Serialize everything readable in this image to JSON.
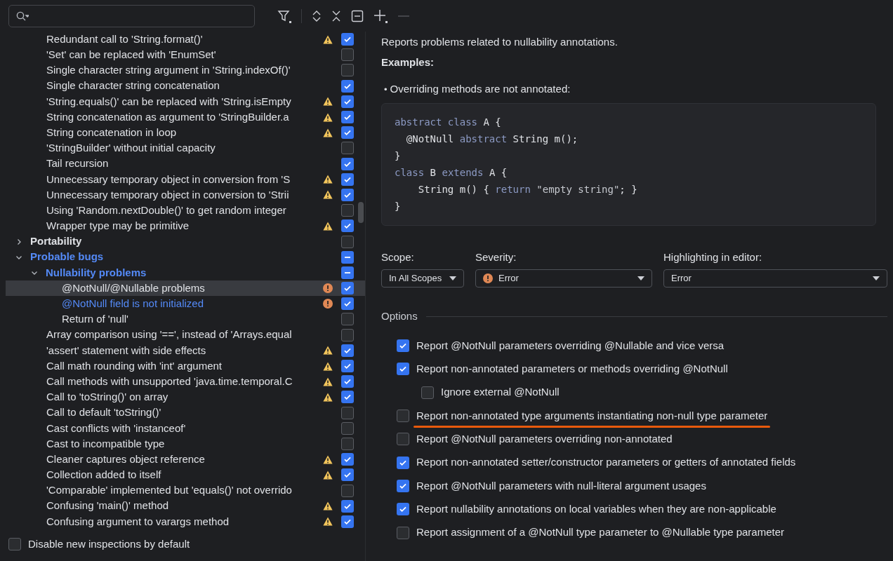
{
  "tree": [
    {
      "kind": "category",
      "children": [
        {
          "kind": "leaf",
          "label": "Redundant call to 'String.format()'",
          "warning": true,
          "error": false,
          "checked": true,
          "modified": false,
          "selected": false
        },
        {
          "kind": "leaf",
          "label": "'Set' can be replaced with 'EnumSet'",
          "warning": false,
          "error": false,
          "checked": false,
          "modified": false,
          "selected": false
        },
        {
          "kind": "leaf",
          "label": "Single character string argument in 'String.indexOf()'",
          "warning": false,
          "error": false,
          "checked": false,
          "modified": false,
          "selected": false
        },
        {
          "kind": "leaf",
          "label": "Single character string concatenation",
          "warning": false,
          "error": false,
          "checked": true,
          "modified": false,
          "selected": false
        },
        {
          "kind": "leaf",
          "label": "'String.equals()' can be replaced with 'String.isEmpty",
          "warning": true,
          "error": false,
          "checked": true,
          "modified": false,
          "selected": false
        },
        {
          "kind": "leaf",
          "label": "String concatenation as argument to 'StringBuilder.a",
          "warning": true,
          "error": false,
          "checked": true,
          "modified": false,
          "selected": false
        },
        {
          "kind": "leaf",
          "label": "String concatenation in loop",
          "warning": true,
          "error": false,
          "checked": true,
          "modified": false,
          "selected": false
        },
        {
          "kind": "leaf",
          "label": "'StringBuilder' without initial capacity",
          "warning": false,
          "error": false,
          "checked": false,
          "modified": false,
          "selected": false
        },
        {
          "kind": "leaf",
          "label": "Tail recursion",
          "warning": false,
          "error": false,
          "checked": true,
          "modified": false,
          "selected": false
        },
        {
          "kind": "leaf",
          "label": "Unnecessary temporary object in conversion from 'S",
          "warning": true,
          "error": false,
          "checked": true,
          "modified": false,
          "selected": false
        },
        {
          "kind": "leaf",
          "label": "Unnecessary temporary object in conversion to 'Strii",
          "warning": true,
          "error": false,
          "checked": true,
          "modified": false,
          "selected": false
        },
        {
          "kind": "leaf",
          "label": "Using 'Random.nextDouble()' to get random integer",
          "warning": false,
          "error": false,
          "checked": false,
          "modified": false,
          "selected": false
        },
        {
          "kind": "leaf",
          "label": "Wrapper type may be primitive",
          "warning": true,
          "error": false,
          "checked": true,
          "modified": false,
          "selected": false
        }
      ]
    },
    {
      "kind": "category",
      "label": "Portability",
      "expanded": false,
      "checked": false,
      "partial": false,
      "modified": false,
      "selected": false
    },
    {
      "kind": "category",
      "label": "Probable bugs",
      "expanded": true,
      "checked": false,
      "partial": true,
      "modified": true,
      "selected": false,
      "children": [
        {
          "kind": "category",
          "label": "Nullability problems",
          "expanded": true,
          "checked": false,
          "partial": true,
          "modified": true,
          "selected": false,
          "children": [
            {
              "kind": "leaf",
              "label": "@NotNull/@Nullable problems",
              "warning": false,
              "error": true,
              "checked": true,
              "modified": false,
              "selected": true
            },
            {
              "kind": "leaf",
              "label": "@NotNull field is not initialized",
              "warning": false,
              "error": true,
              "checked": true,
              "modified": true,
              "selected": false
            },
            {
              "kind": "leaf",
              "label": "Return of 'null'",
              "warning": false,
              "error": false,
              "checked": false,
              "modified": false,
              "selected": false
            }
          ]
        },
        {
          "kind": "leaf",
          "label": "Array comparison using '==', instead of 'Arrays.equal",
          "warning": false,
          "error": false,
          "checked": false,
          "modified": false,
          "selected": false
        },
        {
          "kind": "leaf",
          "label": "'assert' statement with side effects",
          "warning": true,
          "error": false,
          "checked": true,
          "modified": false,
          "selected": false
        },
        {
          "kind": "leaf",
          "label": "Call math rounding with 'int' argument",
          "warning": true,
          "error": false,
          "checked": true,
          "modified": false,
          "selected": false
        },
        {
          "kind": "leaf",
          "label": "Call methods with unsupported 'java.time.temporal.C",
          "warning": true,
          "error": false,
          "checked": true,
          "modified": false,
          "selected": false
        },
        {
          "kind": "leaf",
          "label": "Call to 'toString()' on array",
          "warning": true,
          "error": false,
          "checked": true,
          "modified": false,
          "selected": false
        },
        {
          "kind": "leaf",
          "label": "Call to default 'toString()'",
          "warning": false,
          "error": false,
          "checked": false,
          "modified": false,
          "selected": false
        },
        {
          "kind": "leaf",
          "label": "Cast conflicts with 'instanceof'",
          "warning": false,
          "error": false,
          "checked": false,
          "modified": false,
          "selected": false
        },
        {
          "kind": "leaf",
          "label": "Cast to incompatible type",
          "warning": false,
          "error": false,
          "checked": false,
          "modified": false,
          "selected": false
        },
        {
          "kind": "leaf",
          "label": "Cleaner captures object reference",
          "warning": true,
          "error": false,
          "checked": true,
          "modified": false,
          "selected": false
        },
        {
          "kind": "leaf",
          "label": "Collection added to itself",
          "warning": true,
          "error": false,
          "checked": true,
          "modified": false,
          "selected": false
        },
        {
          "kind": "leaf",
          "label": "'Comparable' implemented but 'equals()' not overrido",
          "warning": false,
          "error": false,
          "checked": false,
          "modified": false,
          "selected": false
        },
        {
          "kind": "leaf",
          "label": "Confusing 'main()' method",
          "warning": true,
          "error": false,
          "checked": true,
          "modified": false,
          "selected": false
        },
        {
          "kind": "leaf",
          "label": "Confusing argument to varargs method",
          "warning": true,
          "error": false,
          "checked": true,
          "modified": false,
          "selected": false
        }
      ]
    }
  ],
  "bottom_option": {
    "label": "Disable new inspections by default",
    "checked": false
  },
  "description": {
    "text": "Reports problems related to nullability annotations.",
    "examples_heading": "Examples:",
    "bullet": "•",
    "bullet_text": "Overriding methods are not annotated:",
    "code": [
      [
        {
          "kind": "keyword",
          "text": "abstract class"
        },
        {
          "kind": "plain",
          "text": " A {"
        }
      ],
      [
        {
          "kind": "plain",
          "text": "  @NotNull "
        },
        {
          "kind": "keyword",
          "text": "abstract"
        },
        {
          "kind": "plain",
          "text": " String m();"
        }
      ],
      [
        {
          "kind": "plain",
          "text": "}"
        }
      ],
      [
        {
          "kind": "keyword",
          "text": "class"
        },
        {
          "kind": "plain",
          "text": " B "
        },
        {
          "kind": "keyword",
          "text": "extends"
        },
        {
          "kind": "plain",
          "text": " A {"
        }
      ],
      [
        {
          "kind": "plain",
          "text": "    String m() { "
        },
        {
          "kind": "keyword",
          "text": "return "
        },
        {
          "kind": "string",
          "text": "\"empty string\""
        },
        {
          "kind": "plain",
          "text": "; }"
        }
      ],
      [
        {
          "kind": "plain",
          "text": "}"
        }
      ]
    ]
  },
  "settings": [
    {
      "label": "Scope:",
      "value": "In All Scopes",
      "error_icon": false
    },
    {
      "label": "Severity:",
      "value": "Error",
      "error_icon": true
    },
    {
      "label": "Highlighting in editor:",
      "value": "Error",
      "error_icon": false
    }
  ],
  "options_heading": "Options",
  "options": [
    {
      "label": "Report @NotNull parameters overriding @Nullable and vice versa",
      "checked": true,
      "underlined": false
    },
    {
      "label": "Report non-annotated parameters or methods overriding @NotNull",
      "checked": true,
      "underlined": false,
      "children": [
        {
          "label": "Ignore external @NotNull",
          "checked": false,
          "underlined": false
        }
      ]
    },
    {
      "label": "Report non-annotated type arguments instantiating non-null type parameter",
      "checked": false,
      "underlined": true
    },
    {
      "label": "Report @NotNull parameters overriding non-annotated",
      "checked": false,
      "underlined": false
    },
    {
      "label": "Report non-annotated setter/constructor parameters or getters of annotated fields",
      "checked": true,
      "underlined": false
    },
    {
      "label": "Report @NotNull parameters with null-literal argument usages",
      "checked": true,
      "underlined": false
    },
    {
      "label": "Report nullability annotations on local variables when they are non-applicable",
      "checked": true,
      "underlined": false
    },
    {
      "label": "Report assignment of a @NotNull type parameter to @Nullable type parameter",
      "checked": false,
      "underlined": false
    }
  ]
}
